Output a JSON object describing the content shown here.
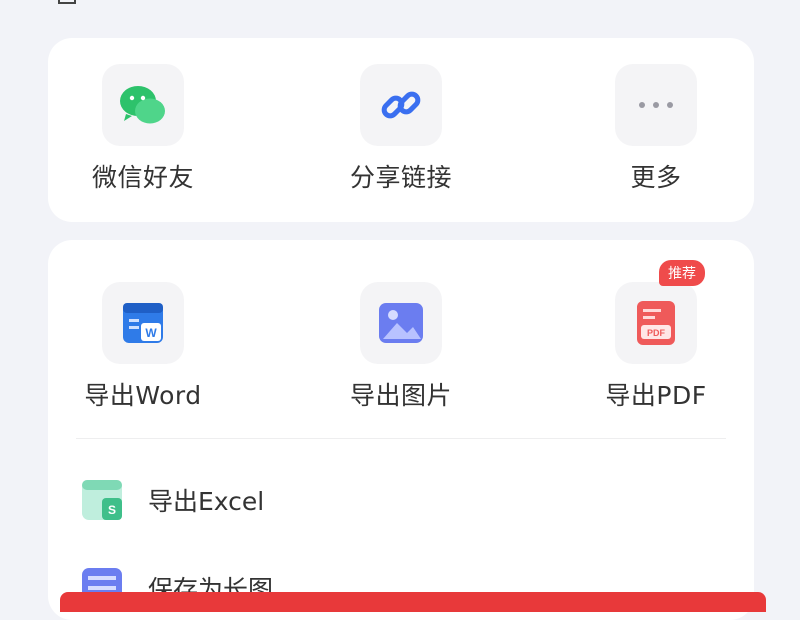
{
  "share": {
    "items": [
      {
        "label": "微信好友",
        "icon": "wechat-icon"
      },
      {
        "label": "分享链接",
        "icon": "link-icon"
      },
      {
        "label": "更多",
        "icon": "more-icon"
      }
    ]
  },
  "export": {
    "items": [
      {
        "label": "导出Word",
        "icon": "word-icon"
      },
      {
        "label": "导出图片",
        "icon": "image-icon"
      },
      {
        "label": "导出PDF",
        "icon": "pdf-icon",
        "badge": "推荐"
      }
    ],
    "rows": [
      {
        "label": "导出Excel",
        "icon": "excel-icon"
      },
      {
        "label": "保存为长图",
        "icon": "long-image-icon"
      }
    ]
  },
  "colors": {
    "background": "#f2f3f8",
    "card": "#ffffff",
    "wechat_green": "#2dc26b",
    "link_blue": "#3a6ff0",
    "word_blue": "#2f7be8",
    "image_purple": "#6b7df0",
    "pdf_red": "#ef5a5a",
    "excel_green": "#3fbf8a",
    "action_red": "#e8393a"
  }
}
